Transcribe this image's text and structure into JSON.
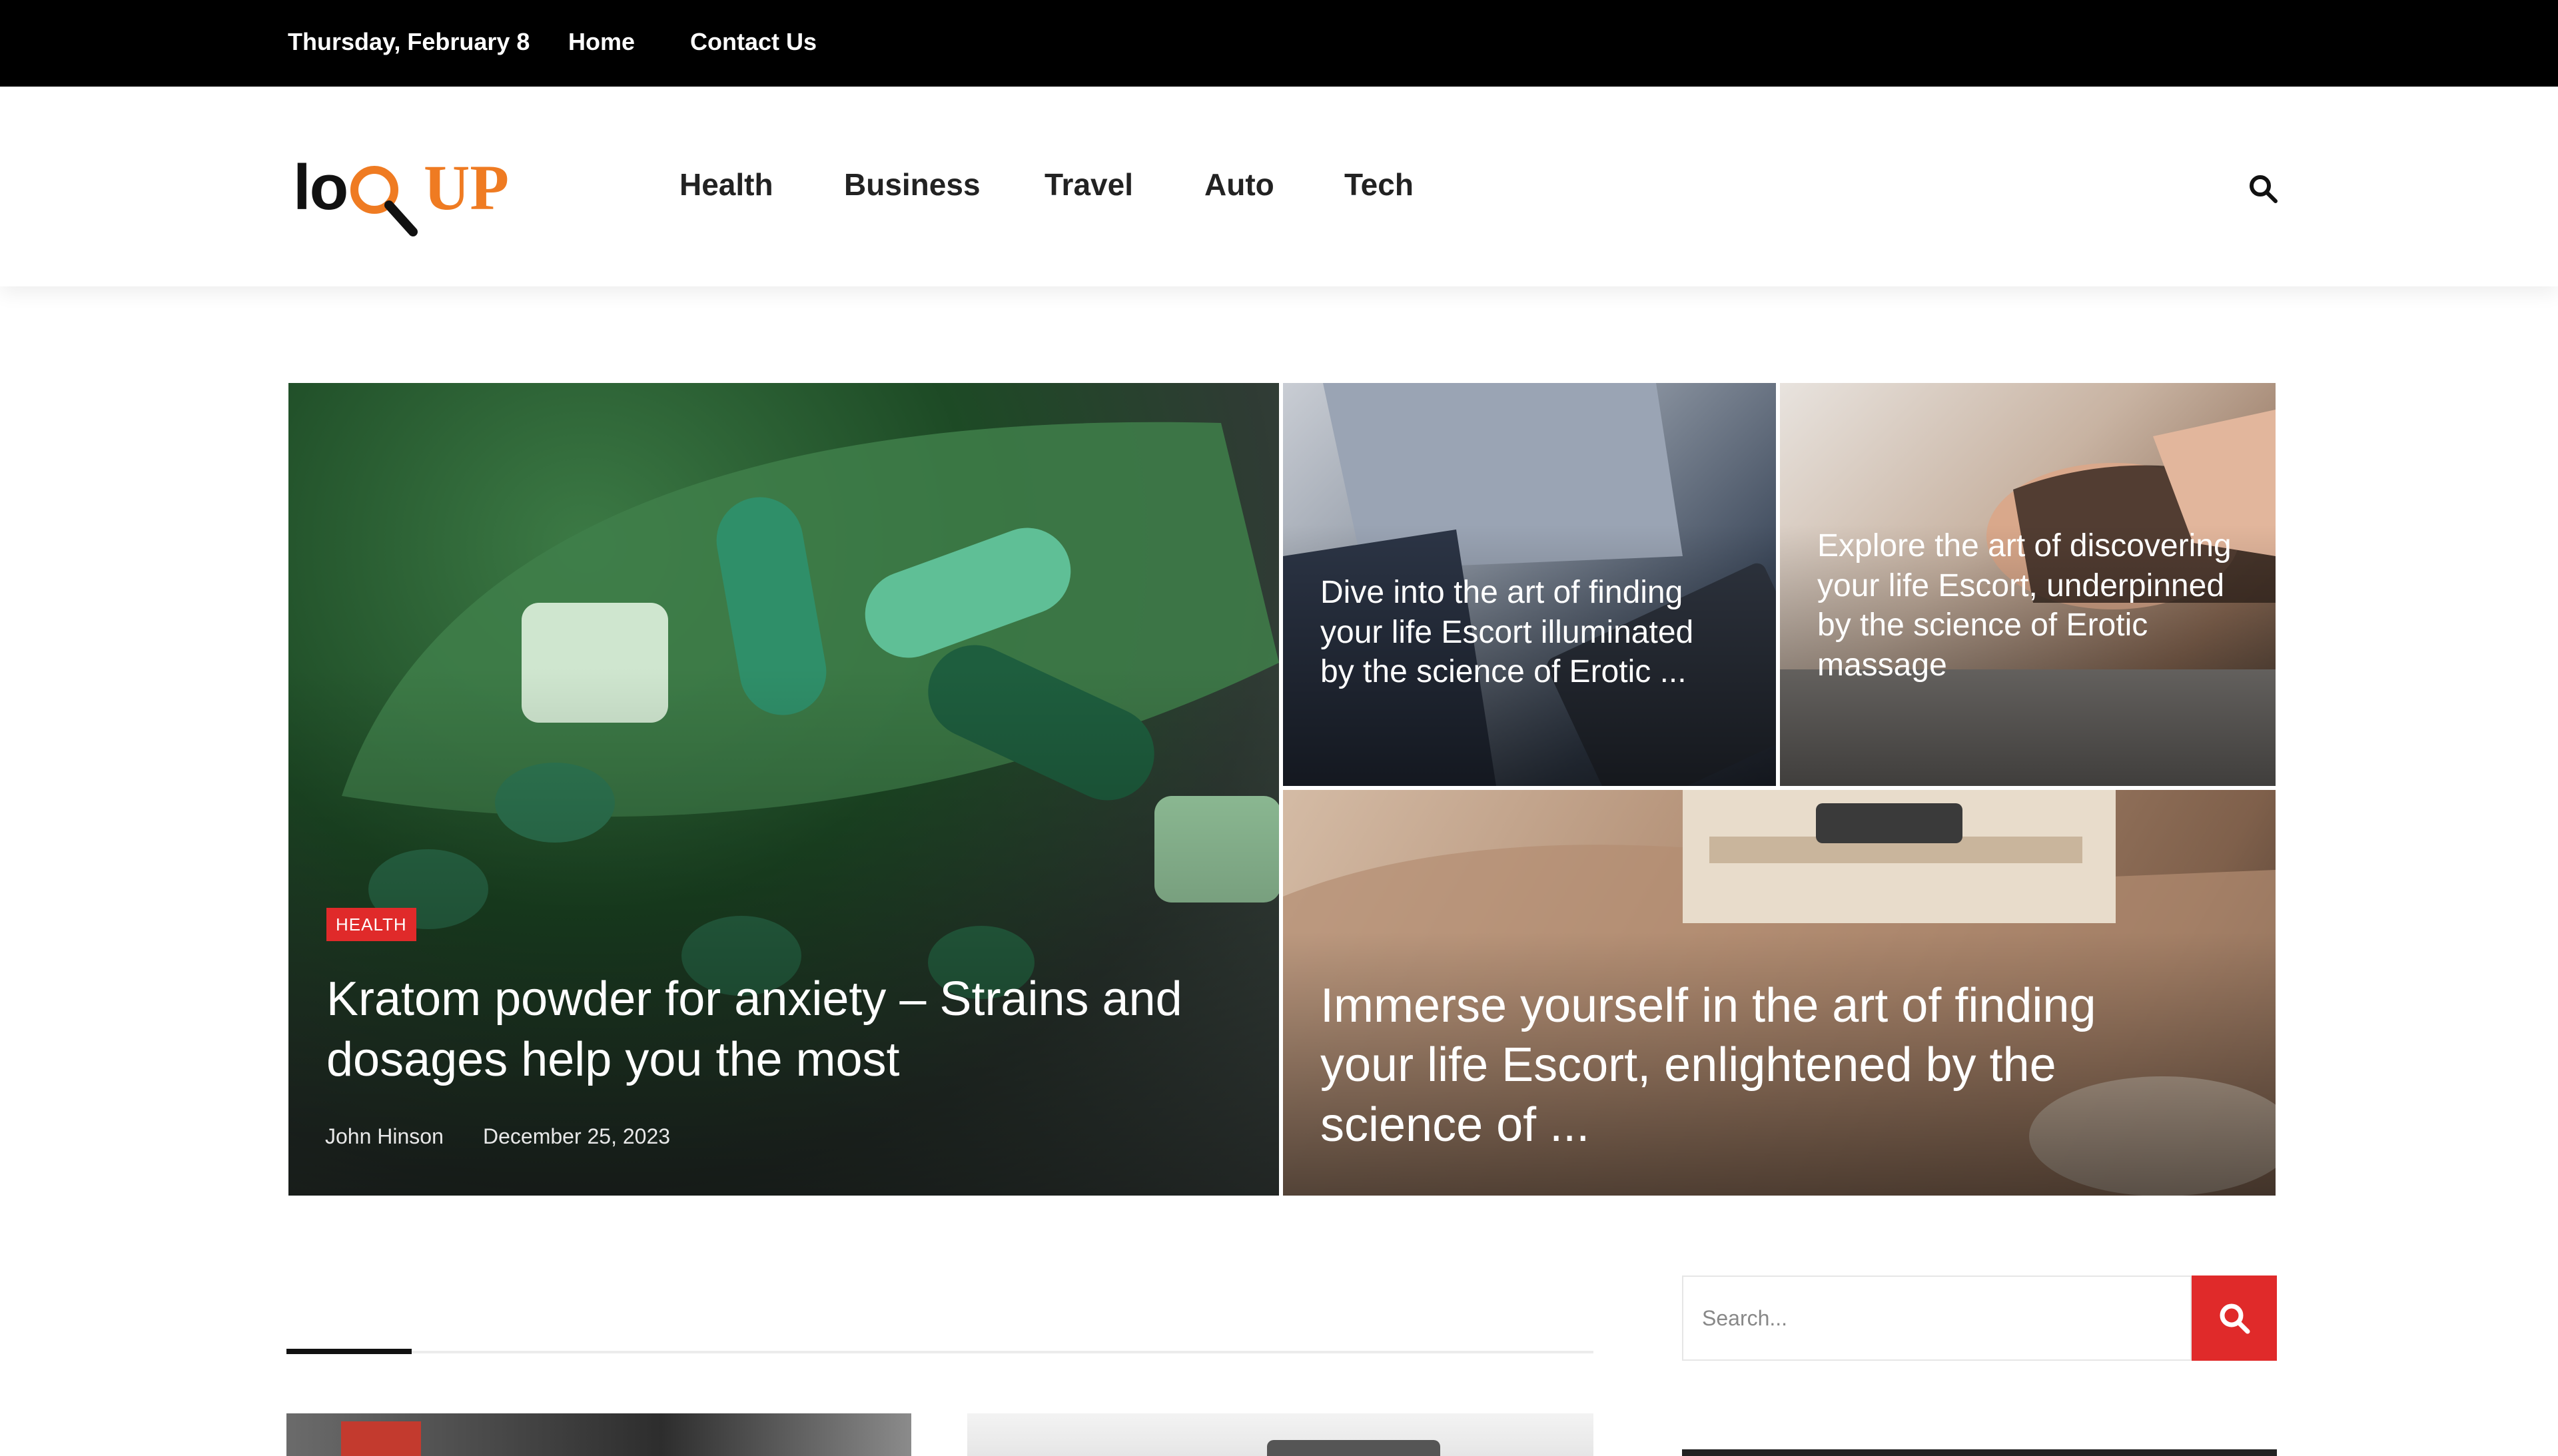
{
  "topbar": {
    "date": "Thursday, February 8",
    "links": [
      "Home",
      "Contact Us"
    ]
  },
  "logo": {
    "text_start": "lo",
    "text_end": "UP",
    "accent_color": "#ef7b22"
  },
  "nav": {
    "items": [
      "Health",
      "Business",
      "Travel",
      "Auto",
      "Tech"
    ],
    "search_icon": "search-icon"
  },
  "hero": {
    "main": {
      "badge": "HEALTH",
      "title": "Kratom powder for anxiety – Strains and dosages help you the most",
      "author": "John Hinson",
      "date": "December 25, 2023"
    },
    "top_middle": {
      "title": "Dive into the art of finding your life Escort illuminated by the science of Erotic ..."
    },
    "top_right": {
      "title": "Explore the art of discovering your life Escort, underpinned by the science of Erotic massage"
    },
    "bottom_wide": {
      "title": "Immerse yourself in the art of finding your life Escort, enlightened by the science of ..."
    }
  },
  "sidebar": {
    "search_placeholder": "Search...",
    "search_button_icon": "search-icon"
  },
  "colors": {
    "topbar_bg": "#000000",
    "accent_red": "#e02a2a"
  }
}
